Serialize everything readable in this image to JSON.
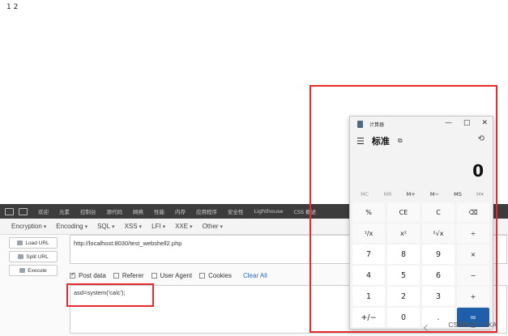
{
  "page": {
    "output_text": "1 2"
  },
  "devtools": {
    "tabs": [
      "欢迎",
      "元素",
      "控制台",
      "源代码",
      "网络",
      "性能",
      "内存",
      "应用程序",
      "安全性",
      "Lighthouse",
      "CSS 概述"
    ]
  },
  "hackbar": {
    "menu": [
      "Encryption",
      "Encoding",
      "SQL",
      "XSS",
      "LFI",
      "XXE",
      "Other"
    ],
    "buttons": {
      "load_url": "Load URL",
      "split_url": "Split URL",
      "execute": "Execute"
    },
    "url_value": "http://localhost:8030/test_webshell2.php",
    "options": [
      {
        "label": "Post data",
        "checked": true
      },
      {
        "label": "Referer",
        "checked": false
      },
      {
        "label": "User Agent",
        "checked": false
      },
      {
        "label": "Cookies",
        "checked": false
      }
    ],
    "clear_all": "Clear All",
    "post_value": "asd=system('calc');"
  },
  "calculator": {
    "title": "计算器",
    "window_controls": [
      "—",
      "□",
      "✕"
    ],
    "mode_title": "标准",
    "display": "0",
    "memory": [
      "MC",
      "MR",
      "M+",
      "M−",
      "MS",
      "M▾"
    ],
    "keys": [
      "%",
      "CE",
      "C",
      "⌫",
      "¹/x",
      "x²",
      "²√x",
      "÷",
      "7",
      "8",
      "9",
      "×",
      "4",
      "5",
      "6",
      "−",
      "1",
      "2",
      "3",
      "+",
      "+/−",
      "0",
      ".",
      "="
    ],
    "colors": {
      "equals": "#1f5ea8"
    }
  },
  "watermark": "CSDN @DMXA",
  "annotations": {
    "highlight_color": "#e62a2a"
  }
}
